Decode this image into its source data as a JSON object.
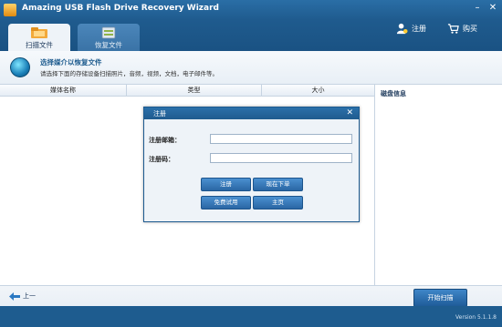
{
  "window": {
    "title": "Amazing USB Flash Drive Recovery Wizard",
    "minimize_glyph": "–",
    "close_glyph": "✕"
  },
  "header": {
    "register_label": "注册",
    "buy_label": "购买"
  },
  "tabs": [
    {
      "label": "扫描文件",
      "active": true,
      "icon": "folder-scan-icon"
    },
    {
      "label": "恢复文件",
      "active": false,
      "icon": "restore-files-icon"
    }
  ],
  "info": {
    "title": "选择媒介以恢复文件",
    "subtitle": "请选择下面的存储设备扫描照片，音频，视频，文档，电子邮件等。"
  },
  "table": {
    "columns": [
      "媒体名称",
      "类型",
      "大小"
    ]
  },
  "disk_panel": {
    "title": "磁盘信息"
  },
  "footer": {
    "back_label": "上一",
    "start_label": "开始扫描",
    "version": "Version 5.1.1.8"
  },
  "dialog": {
    "title": "注册",
    "close_glyph": "✕",
    "email_label": "注册邮箱：",
    "code_label": "注册码：",
    "email_value": "",
    "code_value": "",
    "buttons": {
      "register": "注册",
      "order_now": "现在下单",
      "free_trial": "免费试用",
      "home": "主页"
    }
  },
  "colors": {
    "title_bar": "#1f5b8e",
    "accent_button": "#2a66a4",
    "content_bg": "#ffffff"
  }
}
